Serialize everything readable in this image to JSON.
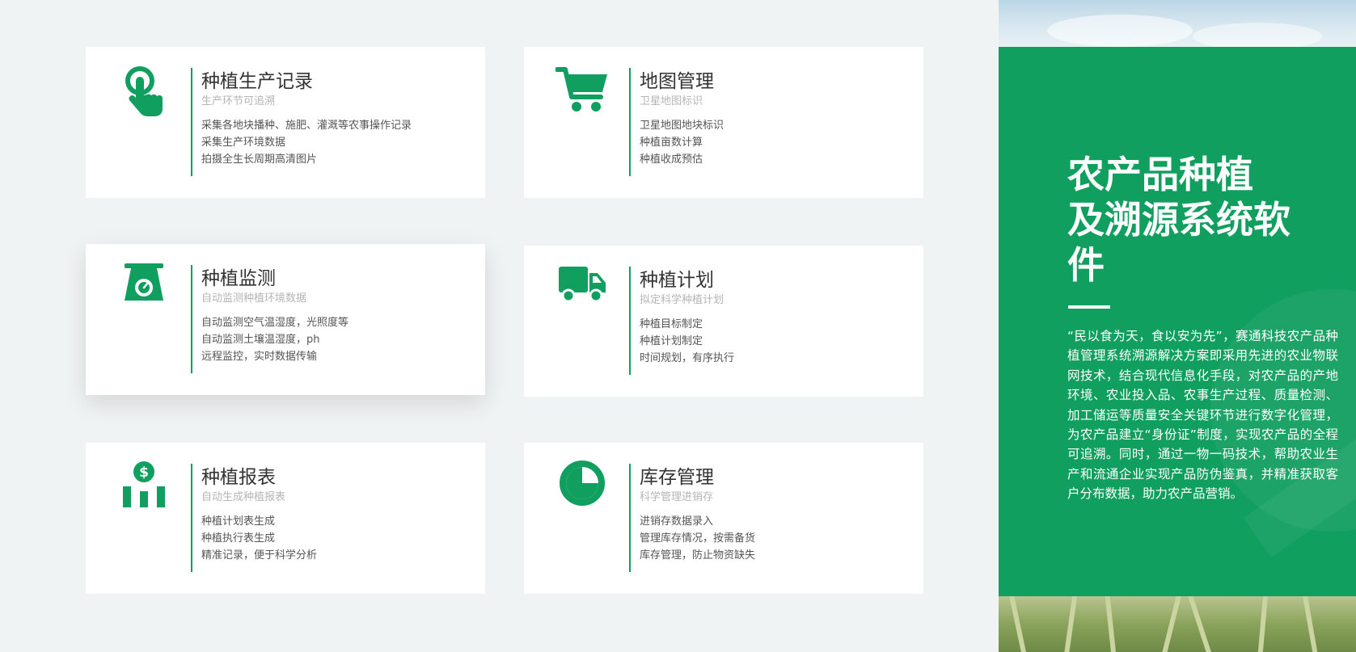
{
  "colors": {
    "accent": "#119f5f",
    "background": "#f0f3f4",
    "card": "#ffffff",
    "title_text": "#333333",
    "subtitle_text": "#b5b5b5",
    "body_text": "#555555"
  },
  "cards": [
    {
      "icon": "tap-hand-icon",
      "title": "种植生产记录",
      "subtitle": "生产环节可追溯",
      "features": [
        "采集各地块播种、施肥、灌溉等农事操作记录",
        "采集生产环境数据",
        "拍摄全生长周期高清图片"
      ]
    },
    {
      "icon": "shopping-cart-icon",
      "title": "地图管理",
      "subtitle": "卫星地图标识",
      "features": [
        "卫星地图地块标识",
        "种植亩数计算",
        "种植收成预估"
      ]
    },
    {
      "icon": "scale-icon",
      "title": "种植监测",
      "subtitle": "自动监测种植环境数据",
      "features": [
        "自动监测空气温湿度，光照度等",
        "自动监测土壤温湿度，ph",
        "远程监控，实时数据传输"
      ]
    },
    {
      "icon": "truck-icon",
      "title": "种植计划",
      "subtitle": "拟定科学种植计划",
      "features": [
        "种植目标制定",
        "种植计划制定",
        "时间规划，有序执行"
      ]
    },
    {
      "icon": "money-chart-icon",
      "title": "种植报表",
      "subtitle": "自动生成种植报表",
      "features": [
        "种植计划表生成",
        "种植执行表生成",
        "精准记录，便于科学分析"
      ]
    },
    {
      "icon": "pie-chart-icon",
      "title": "库存管理",
      "subtitle": "科学管理进销存",
      "features": [
        "进销存数据录入",
        "管理库存情况，按需备货",
        "库存管理，防止物资缺失"
      ]
    }
  ],
  "panel": {
    "title_line1": "农产品种植",
    "title_line2": "及溯源系统软",
    "title_line3": "件",
    "description": "“民以食为天，食以安为先”，赛通科技农产品种植管理系统溯源解决方案即采用先进的农业物联网技术，结合现代信息化手段，对农产品的产地环境、农业投入品、农事生产过程、质量检测、加工储运等质量安全关键环节进行数字化管理，为农产品建立“身份证”制度，实现农产品的全程可追溯。同时，通过一物一码技术，帮助农业生产和流通企业实现产品防伪鉴真，并精准获取客户分布数据，助力农产品营销。"
  }
}
